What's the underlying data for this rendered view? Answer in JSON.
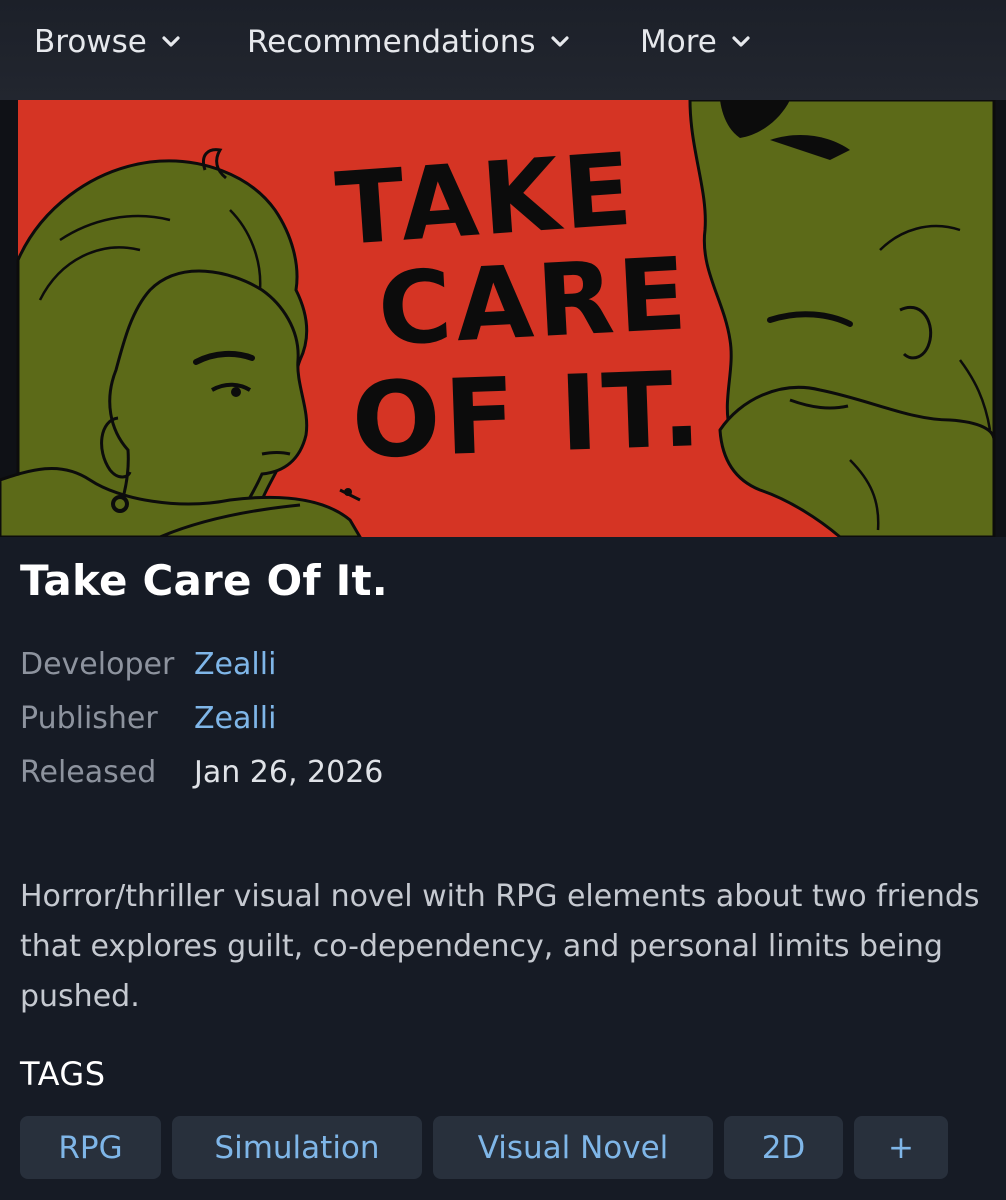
{
  "nav": {
    "items": [
      {
        "label": "Browse"
      },
      {
        "label": "Recommendations"
      },
      {
        "label": "More"
      }
    ]
  },
  "capsule": {
    "art_text": "TAKE CARE OF IT.",
    "colors": {
      "background": "#d53424",
      "figures": "#5c6a18",
      "ink": "#0c0c0c"
    }
  },
  "game": {
    "title": "Take Care Of It.",
    "developer_label": "Developer",
    "developer": "Zealli",
    "publisher_label": "Publisher",
    "publisher": "Zealli",
    "released_label": "Released",
    "released": "Jan 26, 2026",
    "description": "Horror/thriller visual novel with RPG elements about two friends that explores guilt, co-dependency, and personal limits being pushed."
  },
  "tags": {
    "heading": "TAGS",
    "items": [
      {
        "label": "RPG"
      },
      {
        "label": "Simulation"
      },
      {
        "label": "Visual Novel"
      },
      {
        "label": "2D"
      },
      {
        "label": "+"
      }
    ]
  },
  "colors": {
    "page_bg": "#161b25",
    "link": "#7fb6e8",
    "tag_bg": "#28303c"
  }
}
